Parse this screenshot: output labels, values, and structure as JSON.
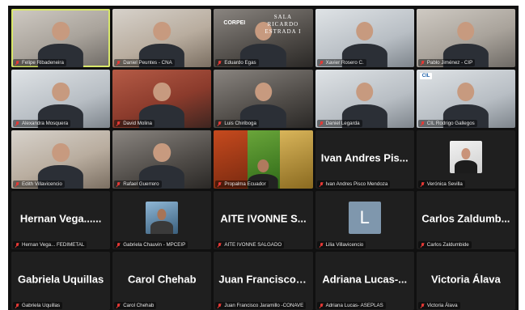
{
  "participants": [
    {
      "label": "Felipe Ribadeneira",
      "kind": "video",
      "tone": "",
      "active": true
    },
    {
      "label": "Daniel Peuntes - CNA",
      "kind": "video",
      "tone": "t-warm"
    },
    {
      "label": "Eduardo Egas",
      "kind": "video",
      "tone": "t-dark",
      "overlay": "corpei",
      "logo_text": "CORPEI",
      "sala_text": "SALA\nRICARDO ESTRADA I"
    },
    {
      "label": "Xavier Rosero C.",
      "kind": "video",
      "tone": "t-cool"
    },
    {
      "label": "Pablo Jiménez - CIP",
      "kind": "video",
      "tone": ""
    },
    {
      "label": "Alexandra Mosquera",
      "kind": "video",
      "tone": "t-cool"
    },
    {
      "label": "David Molina",
      "kind": "video",
      "tone": "t-red"
    },
    {
      "label": "Luis Chiriboga",
      "kind": "video",
      "tone": "t-dark"
    },
    {
      "label": "Daniel Legarda",
      "kind": "video",
      "tone": "t-cool"
    },
    {
      "label": "CIL Rodrigo Gallegos",
      "kind": "video",
      "tone": "t-cool",
      "overlay": "cil",
      "logo_text": "CIL"
    },
    {
      "label": "Edith Villavicencio",
      "kind": "video",
      "tone": "t-warm"
    },
    {
      "label": "Rafael Guerrero",
      "kind": "video",
      "tone": "t-dark"
    },
    {
      "label": "Propalma Ecuador",
      "kind": "promo"
    },
    {
      "label": "Ivan Andres Pisco Mendoza",
      "kind": "name",
      "big": "Ivan Andres Pis..."
    },
    {
      "label": "Verónica Sevilla",
      "kind": "photo",
      "photo": "light"
    },
    {
      "label": "Hernan Vega... FEDIMETAL",
      "kind": "name",
      "big": "Hernan Vega......"
    },
    {
      "label": "Gabriela Chauvin - MPCEIP",
      "kind": "photo",
      "photo": "blue"
    },
    {
      "label": "AITE IVONNE SALGADO",
      "kind": "name",
      "big": "AITE IVONNE S..."
    },
    {
      "label": "Lilia Villavicencio",
      "kind": "letter",
      "letter": "L"
    },
    {
      "label": "Carlos Zaldumbide",
      "kind": "name",
      "big": "Carlos Zaldumb..."
    },
    {
      "label": "Gabriela Uquillas",
      "kind": "name",
      "big": "Gabriela Uquillas"
    },
    {
      "label": "Carol Chehab",
      "kind": "name",
      "big": "Carol Chehab"
    },
    {
      "label": "Juan Francisco Jaramillo -CONAVE",
      "kind": "name",
      "big": "Juan Francisco J..."
    },
    {
      "label": "Adriana Lucas- ASEPLAS",
      "kind": "name",
      "big": "Adriana Lucas-..."
    },
    {
      "label": "Victoria Álava",
      "kind": "name",
      "big": "Victoria Álava"
    }
  ],
  "colors": {
    "active_border": "#d9e86b",
    "muted_mic": "#e53935",
    "tile_bg": "#1f1f1f"
  }
}
